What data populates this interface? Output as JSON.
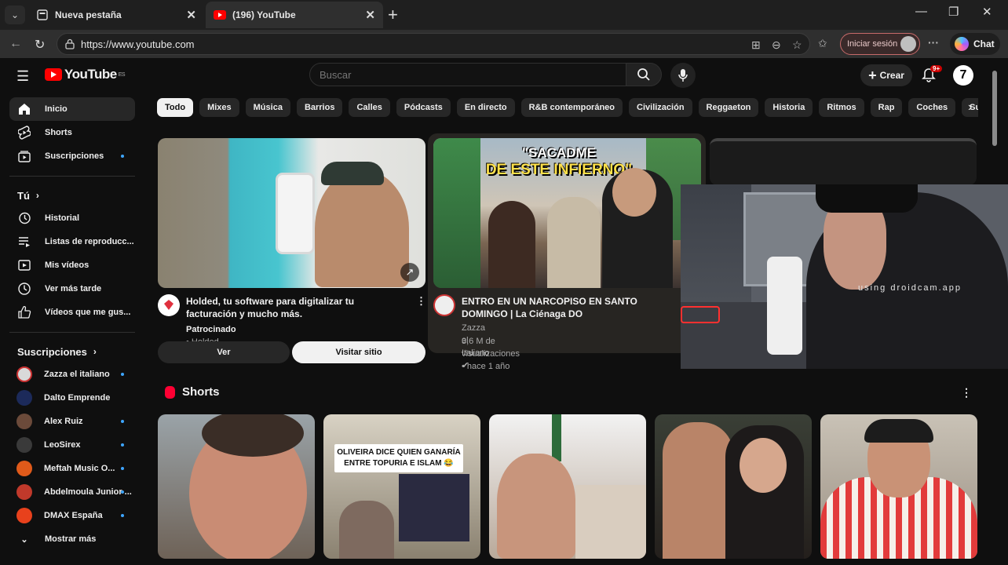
{
  "browser": {
    "tabs": [
      {
        "title": "Nueva pestaña"
      },
      {
        "title": "(196) YouTube"
      }
    ],
    "url": "https://www.youtube.com",
    "signin_label": "Iniciar sesión",
    "chat_label": "Chat"
  },
  "youtube": {
    "logo_text": "YouTube",
    "logo_region": "ES",
    "search_placeholder": "Buscar",
    "create_label": "Crear",
    "notif_badge": "9+",
    "avatar_letter": "7"
  },
  "sidebar": {
    "main": [
      {
        "label": "Inicio",
        "icon": "home-icon"
      },
      {
        "label": "Shorts",
        "icon": "shorts-icon"
      },
      {
        "label": "Suscripciones",
        "icon": "subscriptions-icon"
      }
    ],
    "you_header": "Tú",
    "you": [
      {
        "label": "Historial",
        "icon": "history-icon"
      },
      {
        "label": "Listas de reproducc...",
        "icon": "playlists-icon"
      },
      {
        "label": "Mis vídeos",
        "icon": "my-videos-icon"
      },
      {
        "label": "Ver más tarde",
        "icon": "watch-later-icon"
      },
      {
        "label": "Vídeos que me gus...",
        "icon": "liked-icon"
      }
    ],
    "subs_header": "Suscripciones",
    "subscriptions": [
      {
        "label": "Zazza el italiano",
        "color": "#d9d9d9"
      },
      {
        "label": "Dalto Emprende",
        "color": "#1c2a5a"
      },
      {
        "label": "Alex Ruiz",
        "color": "#6b4a3a"
      },
      {
        "label": "LeoSirex",
        "color": "#3a3a3a"
      },
      {
        "label": "Meftah Music O...",
        "color": "#e05a1a"
      },
      {
        "label": "Abdelmoula Junior ...",
        "color": "#c0392b"
      },
      {
        "label": "DMAX España",
        "color": "#e8411c"
      }
    ],
    "show_more": "Mostrar más"
  },
  "chips": [
    "Todo",
    "Mixes",
    "Música",
    "Barrios",
    "Calles",
    "Pódcasts",
    "En directo",
    "R&B contemporáneo",
    "Civilización",
    "Reggaeton",
    "Historia",
    "Ritmos",
    "Rap",
    "Coches",
    "Subidas recientes"
  ],
  "videos": [
    {
      "title": "Holded, tu software para digitalizar tu facturación y mucho más.",
      "sponsored": "Patrocinado",
      "channel": "Holded",
      "btn_watch": "Ver",
      "btn_visit": "Visitar sitio"
    },
    {
      "title": "ENTRO EN UN NARCOPISO EN SANTO DOMINGO | La Ciénaga DO",
      "channel": "Zazza el Italiano",
      "meta": "3,6 M de visualizaciones • hace 1 año",
      "thumb_text": [
        "\"SACADME",
        "DE ESTE INFIERNO\""
      ]
    }
  ],
  "webcam_text": "using droidcam.app",
  "shorts": {
    "title": "Shorts",
    "items": [
      {
        "overlay": ""
      },
      {
        "overlay": "OLIVEIRA DICE QUIEN GANARÍA ENTRE TOPURIA E ISLAM 😂"
      },
      {
        "overlay": ""
      },
      {
        "overlay": ""
      },
      {
        "overlay": ""
      }
    ]
  }
}
